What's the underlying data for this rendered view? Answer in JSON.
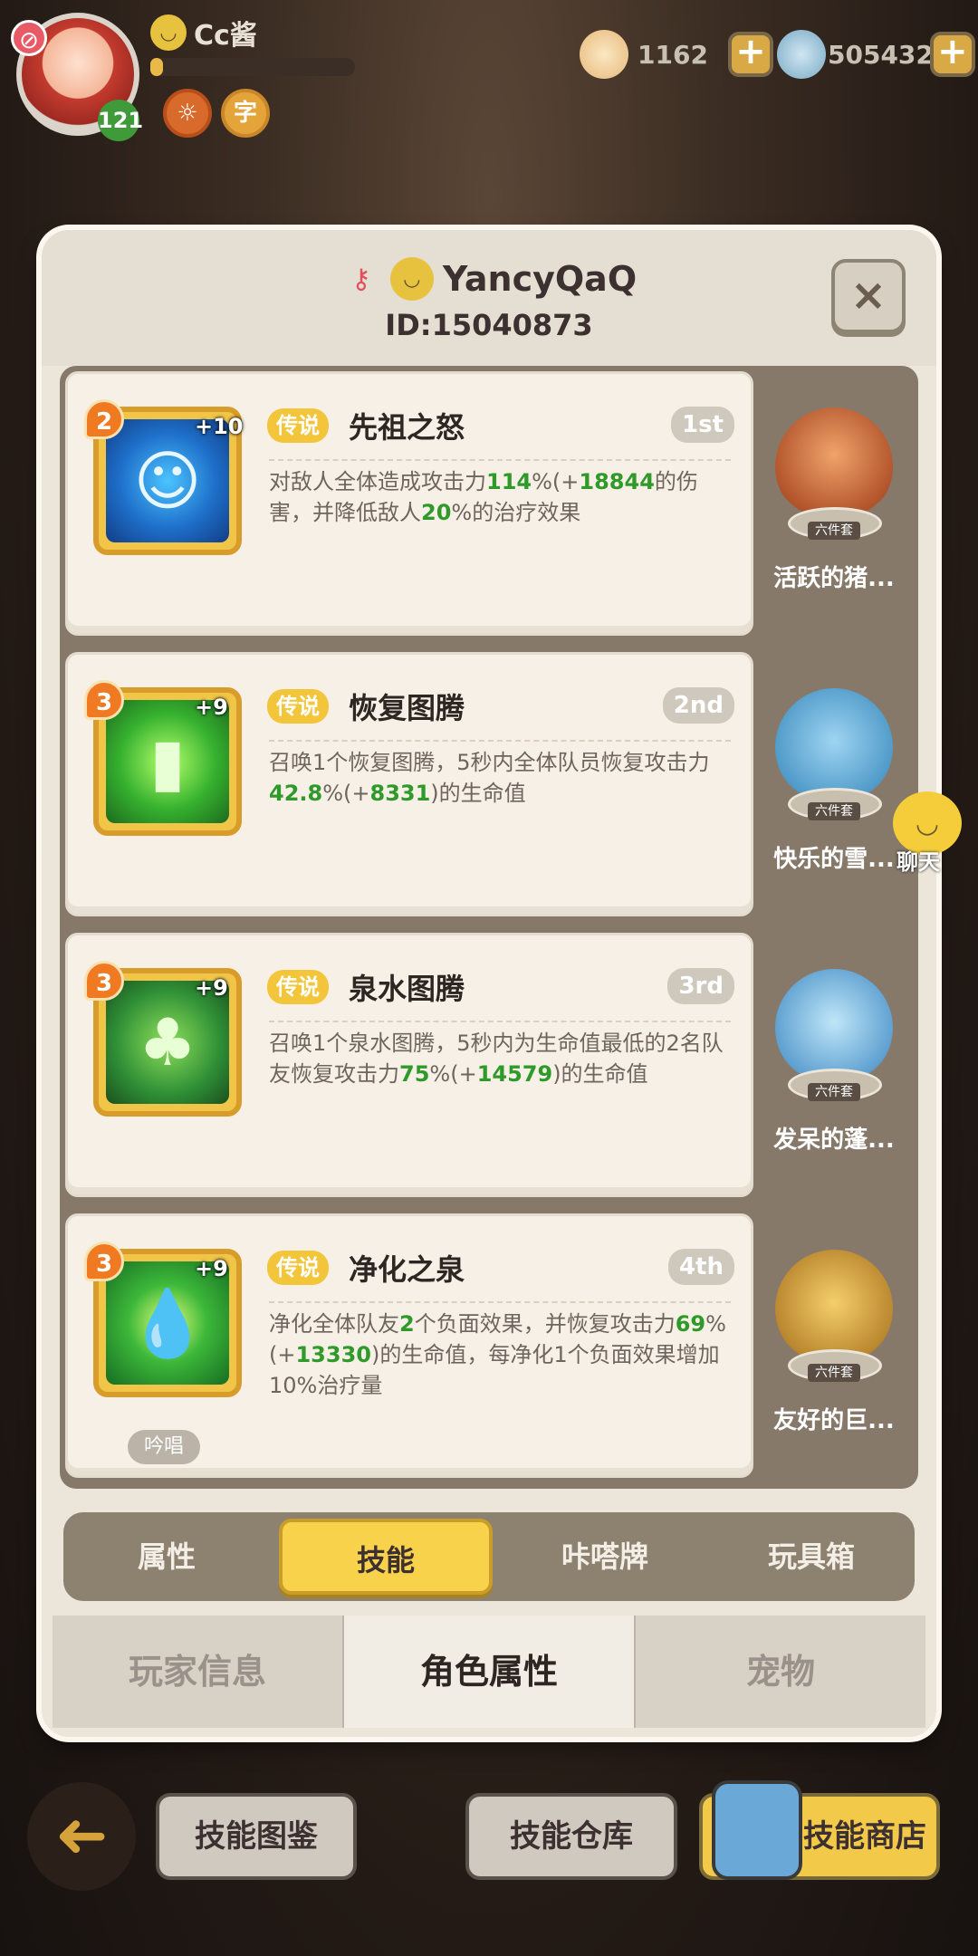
{
  "player": {
    "name": "Cc酱",
    "level": "121",
    "badge1": "☼",
    "badge2": "字"
  },
  "currency": {
    "shells": "1162",
    "stones": "505432",
    "plus": "+"
  },
  "panel": {
    "name": "YancyQaQ",
    "id": "ID:15040873",
    "close": "×"
  },
  "skills": [
    {
      "level": "2",
      "plus": "+10",
      "tag": "传说",
      "name": "先祖之怒",
      "rank": "1st",
      "desc": [
        [
          "对敌人全体造成攻击力",
          0
        ],
        [
          "114",
          1
        ],
        [
          "%(+",
          0
        ],
        [
          "18844",
          1
        ],
        [
          "的伤害，并降低敌人",
          0
        ],
        [
          "20",
          1
        ],
        [
          "%的治疗效果",
          0
        ]
      ]
    },
    {
      "level": "3",
      "plus": "+9",
      "tag": "传说",
      "name": "恢复图腾",
      "rank": "2nd",
      "desc": [
        [
          "召唤1个恢复图腾，5秒内全体队员恢复攻击力",
          0
        ],
        [
          "42.8",
          1
        ],
        [
          "%(+",
          0
        ],
        [
          "8331",
          1
        ],
        [
          ")的生命值",
          0
        ]
      ]
    },
    {
      "level": "3",
      "plus": "+9",
      "tag": "传说",
      "name": "泉水图腾",
      "rank": "3rd",
      "desc": [
        [
          "召唤1个泉水图腾，5秒内为生命值最低的2名队友恢复攻击力",
          0
        ],
        [
          "75",
          1
        ],
        [
          "%(+",
          0
        ],
        [
          "14579",
          1
        ],
        [
          ")的生命值",
          0
        ]
      ]
    },
    {
      "level": "3",
      "plus": "+9",
      "tag": "传说",
      "name": "净化之泉",
      "rank": "4th",
      "chant": "吟唱",
      "desc": [
        [
          "净化全体队友",
          0
        ],
        [
          "2",
          1
        ],
        [
          "个负面效果，并恢复攻击力",
          0
        ],
        [
          "69",
          1
        ],
        [
          "%(+",
          0
        ],
        [
          "13330",
          1
        ],
        [
          ")的生命值，每净化1个负面效果增加10%治疗量",
          0
        ]
      ]
    }
  ],
  "pets": [
    {
      "name": "活跃的猪...",
      "tag": "六件套"
    },
    {
      "name": "快乐的雪...",
      "tag": "六件套"
    },
    {
      "name": "发呆的蓬...",
      "tag": "六件套"
    },
    {
      "name": "友好的巨...",
      "tag": "六件套"
    }
  ],
  "chat": {
    "label": "聊天"
  },
  "subtabs": [
    "属性",
    "技能",
    "咔嗒牌",
    "玩具箱"
  ],
  "maintabs": [
    "玩家信息",
    "角色属性",
    "宠物"
  ],
  "bottom": {
    "collection": "技能图鉴",
    "storage": "技能仓库",
    "shop": "技能商店",
    "back": "➜"
  }
}
